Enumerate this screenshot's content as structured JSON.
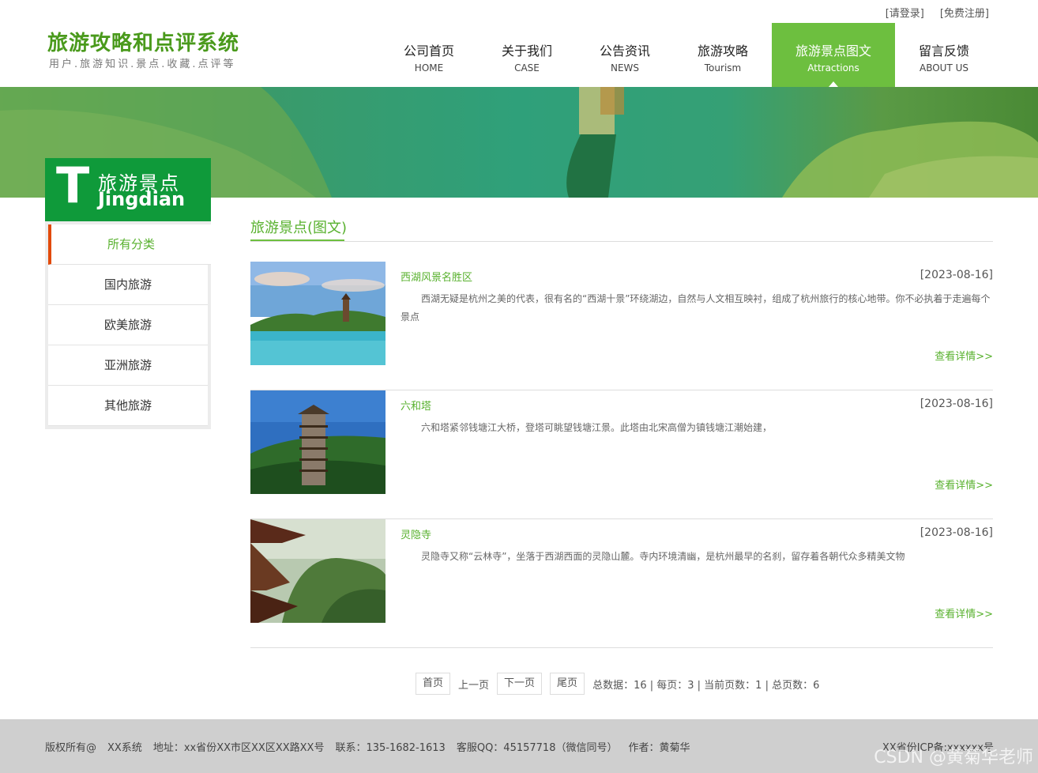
{
  "top_links": {
    "login": "[请登录]",
    "register": "[免费注册]"
  },
  "logo": {
    "title": "旅游攻略和点评系统",
    "subtitle": "用户.旅游知识.景点.收藏.点评等"
  },
  "nav": [
    {
      "cn": "公司首页",
      "en": "HOME"
    },
    {
      "cn": "关于我们",
      "en": "CASE"
    },
    {
      "cn": "公告资讯",
      "en": "NEWS"
    },
    {
      "cn": "旅游攻略",
      "en": "Tourism"
    },
    {
      "cn": "旅游景点图文",
      "en": "Attractions",
      "active": true
    },
    {
      "cn": "留言反馈",
      "en": "ABOUT US"
    }
  ],
  "sidebar": {
    "letter": "T",
    "title_cn": "旅游景点",
    "title_en": "Jingdian",
    "items": [
      {
        "label": "所有分类",
        "active": true
      },
      {
        "label": "国内旅游"
      },
      {
        "label": "欧美旅游"
      },
      {
        "label": "亚洲旅游"
      },
      {
        "label": "其他旅游"
      }
    ]
  },
  "main": {
    "title": "旅游景点(图文)",
    "items": [
      {
        "name": "西湖风景名胜区",
        "date": "[2023-08-16]",
        "desc": "西湖无疑是杭州之美的代表，很有名的“西湖十景”环绕湖边，自然与人文相互映衬，组成了杭州旅行的核心地带。你不必执着于走遍每个景点",
        "more": "查看详情>>"
      },
      {
        "name": "六和塔",
        "date": "[2023-08-16]",
        "desc": "六和塔紧邻钱塘江大桥，登塔可眺望钱塘江景。此塔由北宋高僧为镇钱塘江潮始建，",
        "more": "查看详情>>"
      },
      {
        "name": "灵隐寺",
        "date": "[2023-08-16]",
        "desc": "灵隐寺又称“云林寺”，坐落于西湖西面的灵隐山麓。寺内环境清幽，是杭州最早的名刹，留存着各朝代众多精美文物",
        "more": "查看详情>>"
      }
    ]
  },
  "pager": {
    "first": "首页",
    "prev": "上一页",
    "next": "下一页",
    "last": "尾页",
    "stats": "总数据：16 | 每页：3 | 当前页数：1 | 总页数：6"
  },
  "footer": {
    "copyright": "版权所有@",
    "system": "XX系统",
    "address": "地址：xx省份XX市区XX区XX路XX号",
    "phone": "联系：135-1682-1613",
    "qq": "客服QQ：45157718（微信同号）",
    "author": "作者：黄菊华",
    "icp": "XX省份ICP备:xxxxxx号",
    "watermark": "CSDN @黄菊华老师"
  },
  "colors": {
    "accent": "#6dbf3f",
    "sidebar_head": "#0f9a3a",
    "active_marker": "#e24a0a"
  }
}
